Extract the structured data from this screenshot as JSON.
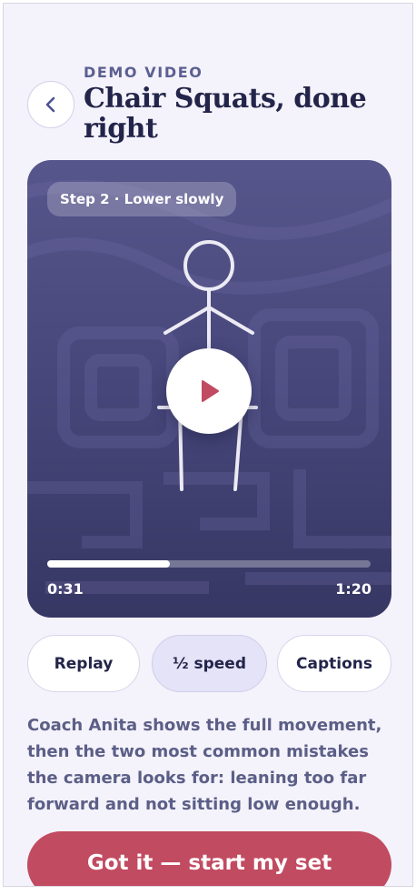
{
  "header": {
    "eyebrow": "DEMO VIDEO",
    "title": "Chair Squats, done right",
    "back_icon": "chevron-left-icon"
  },
  "video": {
    "step_label": "Step 2 · Lower slowly",
    "current_time": "0:31",
    "total_time": "1:20",
    "progress_percent": 38,
    "play_icon": "play-icon"
  },
  "controls": {
    "replay_label": "Replay",
    "speed_label": "½ speed",
    "captions_label": "Captions",
    "active": "speed"
  },
  "description": "Coach Anita shows the full movement, then the two most common mistakes the camera looks for: leaning too far forward and not sitting low enough.",
  "cta_label": "Got it — start my set",
  "colors": {
    "background": "#f4f2fa",
    "accent": "#c14b61",
    "heading": "#23244a",
    "video_bg": "#46467a",
    "active_chip": "#e4e3f7"
  }
}
